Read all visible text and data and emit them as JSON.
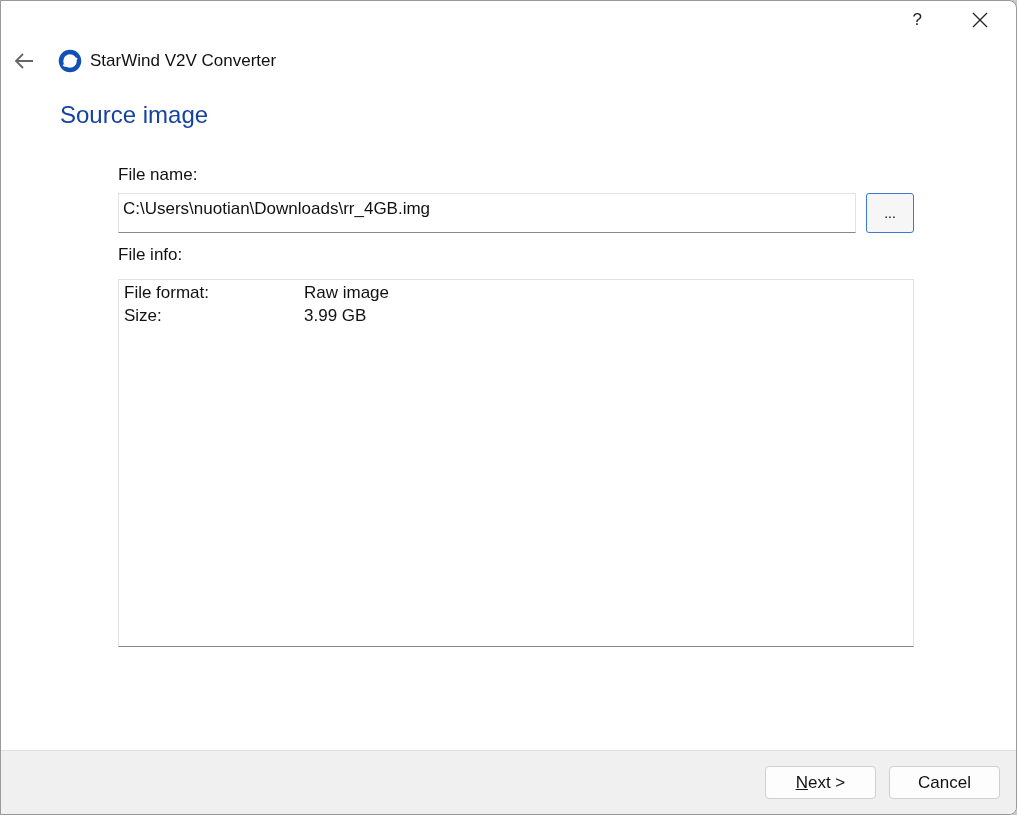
{
  "window": {
    "title": "StarWind V2V Converter",
    "help": "?"
  },
  "page_title": "Source image",
  "file_name": {
    "label": "File name:",
    "value": "C:\\Users\\nuotian\\Downloads\\rr_4GB.img",
    "browse": "..."
  },
  "file_info": {
    "label": "File info:",
    "rows": [
      {
        "label": "File format:",
        "value": "Raw image"
      },
      {
        "label": "Size:",
        "value": "3.99 GB"
      }
    ]
  },
  "buttons": [
    {
      "label": "Next >",
      "kind": "next"
    },
    {
      "label": "Cancel",
      "kind": "cancel"
    }
  ]
}
